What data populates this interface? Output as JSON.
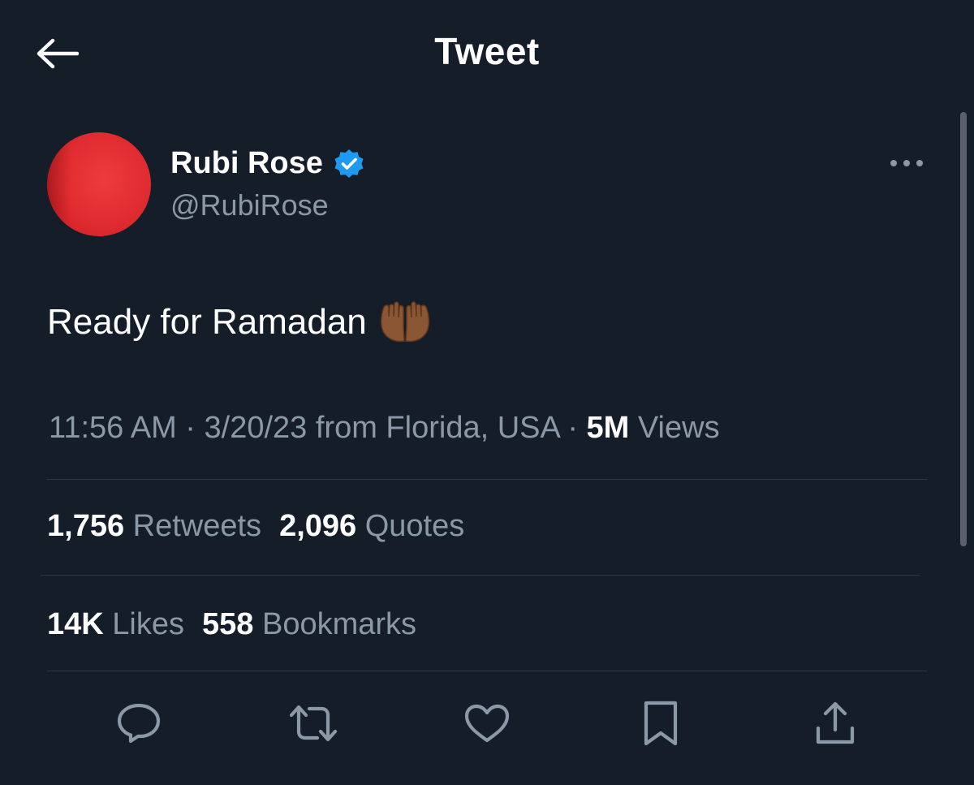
{
  "header": {
    "title": "Tweet",
    "back_icon": "back-arrow-icon"
  },
  "tweet": {
    "author": {
      "display_name": "Rubi Rose",
      "handle": "@RubiRose",
      "verified": true,
      "avatar_color": "#e02c30"
    },
    "text": "Ready for Ramadan",
    "emoji": "palms-up-together-medium-dark-skin-tone",
    "time": "11:56 AM",
    "date": "3/20/23",
    "location_text": "from Florida, USA",
    "separator": "·",
    "views_count": "5M",
    "views_label": "Views"
  },
  "engagement": {
    "retweets": {
      "count": "1,756",
      "label": "Retweets"
    },
    "quotes": {
      "count": "2,096",
      "label": "Quotes"
    },
    "likes": {
      "count": "14K",
      "label": "Likes"
    },
    "bookmarks": {
      "count": "558",
      "label": "Bookmarks"
    }
  },
  "actions": [
    {
      "name": "reply",
      "icon": "reply-icon"
    },
    {
      "name": "retweet",
      "icon": "retweet-icon"
    },
    {
      "name": "like",
      "icon": "heart-icon"
    },
    {
      "name": "bookmark",
      "icon": "bookmark-icon"
    },
    {
      "name": "share",
      "icon": "share-icon"
    }
  ],
  "colors": {
    "background": "#151d28",
    "primary_text": "#ffffff",
    "secondary_text": "#8b98a5",
    "divider": "#2f3944",
    "verified_blue": "#1d9bf0"
  }
}
